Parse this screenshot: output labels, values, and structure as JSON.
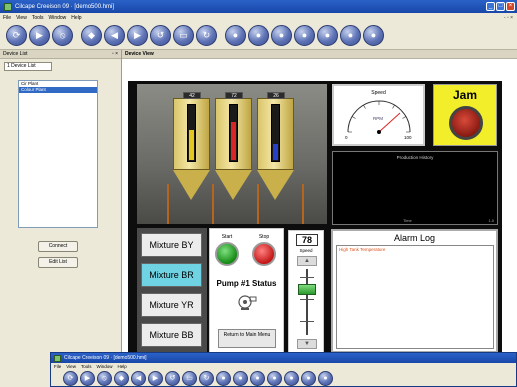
{
  "window": {
    "title": "Cilcape Creeison 09 · [demo500.hmi]",
    "min": "_",
    "max": "□",
    "close": "×"
  },
  "menu": {
    "items": [
      "File",
      "View",
      "Tools",
      "Window",
      "Help"
    ],
    "mdi_controls": "- ▫ ×"
  },
  "toolbar": {
    "icons": [
      "refresh-icon",
      "play-icon",
      "stop-icon",
      "tag-icon",
      "back-icon",
      "forward-icon",
      "undo-icon",
      "screen-icon",
      "redo-icon",
      "record-icon",
      "record-icon",
      "record-icon",
      "record-icon",
      "record-icon",
      "record-icon",
      "record-icon"
    ]
  },
  "device_list": {
    "header": "Device List",
    "header_controls": "▫ ×",
    "tab": "1 Device List",
    "items": [
      "Cir Plant",
      "Colour Plant"
    ],
    "selected": 1,
    "connect": "Connect",
    "edit": "Edit List"
  },
  "device_view": {
    "header": "Device View"
  },
  "tanks": [
    {
      "readout": "42",
      "level": 0.55,
      "color": "#e5c61c"
    },
    {
      "readout": "72",
      "level": 0.7,
      "color": "#d82727"
    },
    {
      "readout": "26",
      "level": 0.3,
      "color": "#2840c8"
    }
  ],
  "speedometer": {
    "title": "Speed",
    "unit": "RPM",
    "min": "0",
    "max": "100"
  },
  "jam": {
    "title": "Jam"
  },
  "history": {
    "title": "Production History",
    "x_left": "Time",
    "x_right": "1.0"
  },
  "mixtures": [
    {
      "label": "Mixture BY",
      "active": false
    },
    {
      "label": "Mixture BR",
      "active": true
    },
    {
      "label": "Mixture YR",
      "active": false
    },
    {
      "label": "Mixture BB",
      "active": false
    }
  ],
  "pump": {
    "start": "Start",
    "stop": "Stop",
    "status": "Pump #1 Status",
    "return": "Return to Main Menu"
  },
  "speed_control": {
    "value": "78",
    "label": "Speed",
    "up": "▲",
    "down": "▼"
  },
  "alarm": {
    "title": "Alarm Log",
    "items": [
      "High Tank Temperature"
    ]
  },
  "lower_window": {
    "title": "Cilcape Creeison 09 · [demo500.hmi]",
    "menu": [
      "File",
      "View",
      "Tools",
      "Window",
      "Help"
    ]
  }
}
